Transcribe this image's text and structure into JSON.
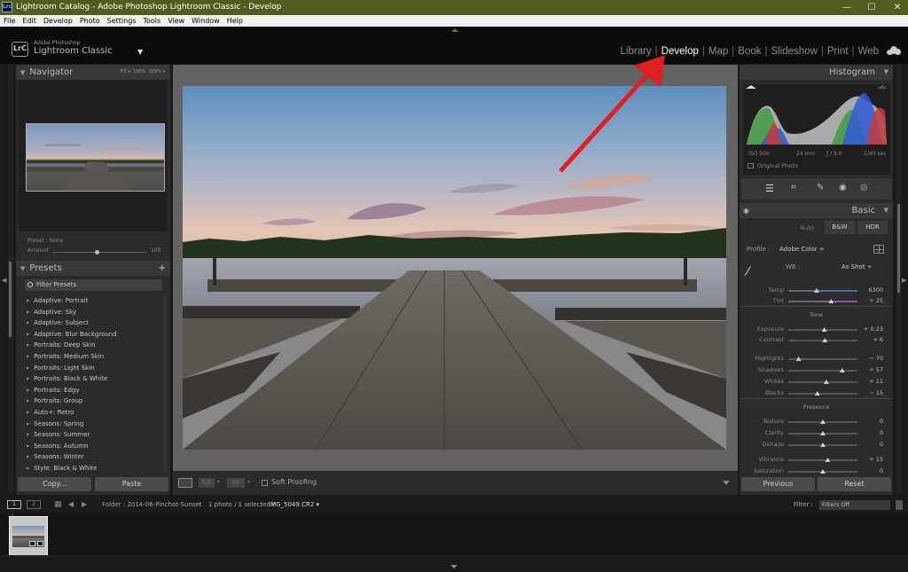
{
  "window": {
    "title": "Lightroom Catalog - Adobe Photoshop Lightroom Classic - Develop",
    "app_icon": "Lrc",
    "controls": [
      "—",
      "☐",
      "✕"
    ]
  },
  "menu": [
    "File",
    "Edit",
    "Develop",
    "Photo",
    "Settings",
    "Tools",
    "View",
    "Window",
    "Help"
  ],
  "identity": {
    "logo": "LrC",
    "line1": "Adobe Photoshop",
    "line2": "Lightroom Classic",
    "caret": "▼"
  },
  "modules": {
    "items": [
      "Library",
      "Develop",
      "Map",
      "Book",
      "Slideshow",
      "Print",
      "Web"
    ],
    "active": "Develop"
  },
  "navigator": {
    "title": "Navigator",
    "zoom": [
      "FIT ▾",
      "100%",
      "300% ▾"
    ],
    "preset_label": "Preset : None",
    "amount_label": "Amount",
    "amount_value": "100"
  },
  "presets": {
    "title": "Presets",
    "add": "+",
    "filter_placeholder": "Filter Presets",
    "items": [
      "Adaptive: Portrait",
      "Adaptive: Sky",
      "Adaptive: Subject",
      "Adaptive: Blur Background",
      "Portraits: Deep Skin",
      "Portraits: Medium Skin",
      "Portraits: Light Skin",
      "Portraits: Black & White",
      "Portraits: Edgy",
      "Portraits: Group",
      "Auto+: Retro",
      "Seasons: Spring",
      "Seasons: Summer",
      "Seasons: Autumn",
      "Seasons: Winter",
      "Style: Black & White"
    ]
  },
  "left_buttons": {
    "copy": "Copy...",
    "paste": "Paste"
  },
  "toolbar": {
    "soft_proofing": "Soft Proofing",
    "view_rxr": "R|R",
    "view_yy": "Y|Y"
  },
  "histogram": {
    "title": "Histogram",
    "iso": "ISO 500",
    "focal": "24 mm",
    "aperture": "ƒ / 9.0",
    "shutter": "1/40 sec",
    "original_photo": "Original Photo"
  },
  "basic": {
    "title": "Basic",
    "treatments": [
      "Auto",
      "B&W",
      "HDR"
    ],
    "profile_label": "Profile :",
    "profile_value": "Adobe Color ÷",
    "wb_label": "WB :",
    "wb_value": "As Shot ÷",
    "tone_label": "Tone",
    "presence_label": "Presence",
    "sliders": [
      {
        "label": "Temp",
        "value": "6300",
        "pos": 0.41,
        "group": "wb",
        "color": "#3c6ebf"
      },
      {
        "label": "Tint",
        "value": "+ 25",
        "pos": 0.62,
        "group": "wb",
        "color": "#9b4fc0"
      },
      {
        "label": "Exposure",
        "value": "+ 0.23",
        "pos": 0.52,
        "group": "tone"
      },
      {
        "label": "Contrast",
        "value": "+ 6",
        "pos": 0.53,
        "group": "tone"
      },
      {
        "label": "Highlights",
        "value": "− 70",
        "pos": 0.15,
        "group": "tone2"
      },
      {
        "label": "Shadows",
        "value": "+ 57",
        "pos": 0.78,
        "group": "tone2"
      },
      {
        "label": "Whites",
        "value": "+ 11",
        "pos": 0.55,
        "group": "tone2"
      },
      {
        "label": "Blacks",
        "value": "− 15",
        "pos": 0.42,
        "group": "tone2"
      },
      {
        "label": "Texture",
        "value": "0",
        "pos": 0.5,
        "group": "presence"
      },
      {
        "label": "Clarity",
        "value": "0",
        "pos": 0.5,
        "group": "presence"
      },
      {
        "label": "Dehaze",
        "value": "0",
        "pos": 0.5,
        "group": "presence"
      },
      {
        "label": "Vibrance",
        "value": "+ 15",
        "pos": 0.57,
        "group": "presence2"
      },
      {
        "label": "Saturation",
        "value": "0",
        "pos": 0.5,
        "group": "presence2"
      }
    ]
  },
  "right_buttons": {
    "previous": "Previous",
    "reset": "Reset"
  },
  "filmstrip": {
    "page1": "1",
    "page2": "2",
    "folder": "Folder : 2014-06-Pinchot-Sunset",
    "selection": "1 photo / 1 selected /",
    "filename": "IMG_5049.CR2 ▾",
    "filter_label": "Filter :",
    "filter_value": "Filters Off",
    "thumb_number": "1"
  },
  "accent": {
    "arrow": "#e02020",
    "active_module": "#ffffff"
  }
}
